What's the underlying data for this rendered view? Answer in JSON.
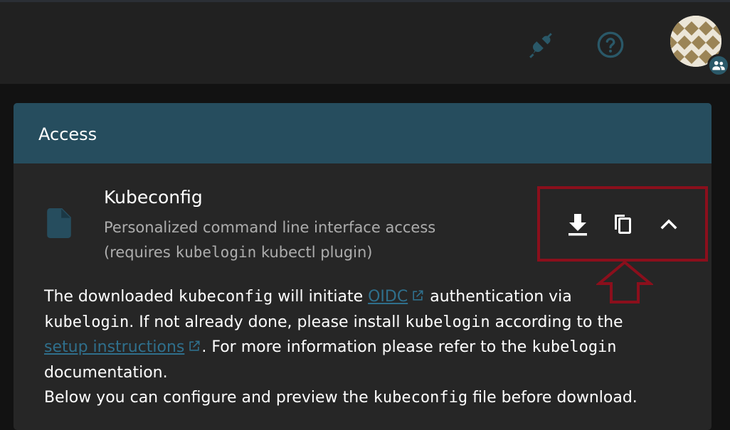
{
  "colors": {
    "accent_header": "#264d5e",
    "background": "#121212",
    "surface": "#262626",
    "topbar": "#212121",
    "link": "#2f6f8c",
    "highlight": "#8b0f1c",
    "topbar_icon": "#2a5868"
  },
  "topbar": {
    "icons": [
      "plug-disconnected-icon",
      "help-circle-icon"
    ],
    "avatar_badge_icon": "group-icon"
  },
  "card": {
    "title": "Access",
    "item": {
      "icon": "file-icon",
      "title": "Kubeconfig",
      "subtitle_line1": "Personalized command line interface access",
      "subtitle_line2_pre": "(requires ",
      "subtitle_line2_code": "kubelogin",
      "subtitle_line2_post": " kubectl plugin)"
    },
    "actions": [
      "download-icon",
      "copy-icon",
      "chevron-up-icon"
    ]
  },
  "description": {
    "l1_a": "The downloaded ",
    "l1_code": "kubeconfig",
    "l1_b": " will initiate ",
    "l1_link": "OIDC",
    "l1_c": " authentication via",
    "l2_code": "kubelogin",
    "l2_a": ". If not already done, please install ",
    "l2_code2": "kubelogin",
    "l2_b": " according to the",
    "l3_link": "setup instructions",
    "l3_a": ". For more information please refer to the ",
    "l3_code": "kubelogin",
    "l4": "documentation.",
    "l5_a": "Below you can configure and preview the ",
    "l5_code": "kubeconfig",
    "l5_b": " file before download."
  }
}
